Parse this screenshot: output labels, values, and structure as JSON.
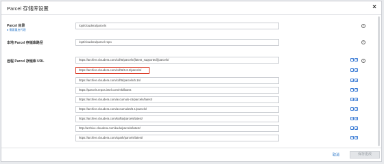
{
  "dialog": {
    "title": "Parcel 存储库设置",
    "close_glyph": "×"
  },
  "parcel_dir": {
    "label": "Parcel 目录",
    "hint": "● 需要重启代理",
    "value": "/opt/cloudera/parcels"
  },
  "local_repo": {
    "label": "本地 Parcel 存储库路径",
    "value": "/opt/cloudera/parcel-repo"
  },
  "remote_urls": {
    "label": "远程 Parcel 存储库 URL",
    "items": [
      "https://archive.cloudera.com/cdh5/parcels/{latest_supported}/parcels/",
      "https://archive.cloudera.com/cdh6/6.3.2/parcels/",
      "https://archive.cloudera.com/cdh5/parcels/5.16/",
      "https://parcels.repos.intel.com/mkl/latest",
      "https://archive.cloudera.com/accumulo-c5/parcels/latest/",
      "https://archive.cloudera.com/accumulo6/6.1/parcels/",
      "https://archive.cloudera.com/kafka/parcels/latest/",
      "http://archive.cloudera.com/kudu/parcels/latest/",
      "https://archive.cloudera.com/spark/parcels/latest/"
    ]
  },
  "help_glyph": "?",
  "remove_glyph": "−",
  "add_glyph": "+",
  "footer": {
    "cancel": "取消",
    "save": "保存更改"
  }
}
